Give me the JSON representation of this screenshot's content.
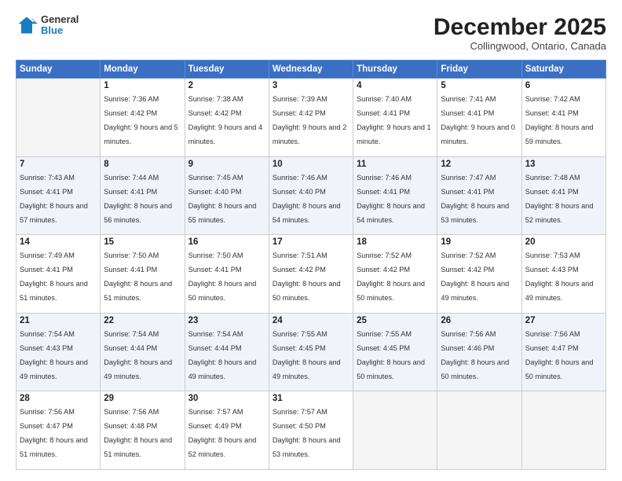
{
  "logo": {
    "general": "General",
    "blue": "Blue"
  },
  "header": {
    "month": "December 2025",
    "location": "Collingwood, Ontario, Canada"
  },
  "days_of_week": [
    "Sunday",
    "Monday",
    "Tuesday",
    "Wednesday",
    "Thursday",
    "Friday",
    "Saturday"
  ],
  "weeks": [
    [
      {
        "day": "",
        "empty": true
      },
      {
        "day": "1",
        "sunrise": "Sunrise: 7:36 AM",
        "sunset": "Sunset: 4:42 PM",
        "daylight": "Daylight: 9 hours and 5 minutes."
      },
      {
        "day": "2",
        "sunrise": "Sunrise: 7:38 AM",
        "sunset": "Sunset: 4:42 PM",
        "daylight": "Daylight: 9 hours and 4 minutes."
      },
      {
        "day": "3",
        "sunrise": "Sunrise: 7:39 AM",
        "sunset": "Sunset: 4:42 PM",
        "daylight": "Daylight: 9 hours and 2 minutes."
      },
      {
        "day": "4",
        "sunrise": "Sunrise: 7:40 AM",
        "sunset": "Sunset: 4:41 PM",
        "daylight": "Daylight: 9 hours and 1 minute."
      },
      {
        "day": "5",
        "sunrise": "Sunrise: 7:41 AM",
        "sunset": "Sunset: 4:41 PM",
        "daylight": "Daylight: 9 hours and 0 minutes."
      },
      {
        "day": "6",
        "sunrise": "Sunrise: 7:42 AM",
        "sunset": "Sunset: 4:41 PM",
        "daylight": "Daylight: 8 hours and 59 minutes."
      }
    ],
    [
      {
        "day": "7",
        "sunrise": "Sunrise: 7:43 AM",
        "sunset": "Sunset: 4:41 PM",
        "daylight": "Daylight: 8 hours and 57 minutes."
      },
      {
        "day": "8",
        "sunrise": "Sunrise: 7:44 AM",
        "sunset": "Sunset: 4:41 PM",
        "daylight": "Daylight: 8 hours and 56 minutes."
      },
      {
        "day": "9",
        "sunrise": "Sunrise: 7:45 AM",
        "sunset": "Sunset: 4:40 PM",
        "daylight": "Daylight: 8 hours and 55 minutes."
      },
      {
        "day": "10",
        "sunrise": "Sunrise: 7:46 AM",
        "sunset": "Sunset: 4:40 PM",
        "daylight": "Daylight: 8 hours and 54 minutes."
      },
      {
        "day": "11",
        "sunrise": "Sunrise: 7:46 AM",
        "sunset": "Sunset: 4:41 PM",
        "daylight": "Daylight: 8 hours and 54 minutes."
      },
      {
        "day": "12",
        "sunrise": "Sunrise: 7:47 AM",
        "sunset": "Sunset: 4:41 PM",
        "daylight": "Daylight: 8 hours and 53 minutes."
      },
      {
        "day": "13",
        "sunrise": "Sunrise: 7:48 AM",
        "sunset": "Sunset: 4:41 PM",
        "daylight": "Daylight: 8 hours and 52 minutes."
      }
    ],
    [
      {
        "day": "14",
        "sunrise": "Sunrise: 7:49 AM",
        "sunset": "Sunset: 4:41 PM",
        "daylight": "Daylight: 8 hours and 51 minutes."
      },
      {
        "day": "15",
        "sunrise": "Sunrise: 7:50 AM",
        "sunset": "Sunset: 4:41 PM",
        "daylight": "Daylight: 8 hours and 51 minutes."
      },
      {
        "day": "16",
        "sunrise": "Sunrise: 7:50 AM",
        "sunset": "Sunset: 4:41 PM",
        "daylight": "Daylight: 8 hours and 50 minutes."
      },
      {
        "day": "17",
        "sunrise": "Sunrise: 7:51 AM",
        "sunset": "Sunset: 4:42 PM",
        "daylight": "Daylight: 8 hours and 50 minutes."
      },
      {
        "day": "18",
        "sunrise": "Sunrise: 7:52 AM",
        "sunset": "Sunset: 4:42 PM",
        "daylight": "Daylight: 8 hours and 50 minutes."
      },
      {
        "day": "19",
        "sunrise": "Sunrise: 7:52 AM",
        "sunset": "Sunset: 4:42 PM",
        "daylight": "Daylight: 8 hours and 49 minutes."
      },
      {
        "day": "20",
        "sunrise": "Sunrise: 7:53 AM",
        "sunset": "Sunset: 4:43 PM",
        "daylight": "Daylight: 8 hours and 49 minutes."
      }
    ],
    [
      {
        "day": "21",
        "sunrise": "Sunrise: 7:54 AM",
        "sunset": "Sunset: 4:43 PM",
        "daylight": "Daylight: 8 hours and 49 minutes."
      },
      {
        "day": "22",
        "sunrise": "Sunrise: 7:54 AM",
        "sunset": "Sunset: 4:44 PM",
        "daylight": "Daylight: 8 hours and 49 minutes."
      },
      {
        "day": "23",
        "sunrise": "Sunrise: 7:54 AM",
        "sunset": "Sunset: 4:44 PM",
        "daylight": "Daylight: 8 hours and 49 minutes."
      },
      {
        "day": "24",
        "sunrise": "Sunrise: 7:55 AM",
        "sunset": "Sunset: 4:45 PM",
        "daylight": "Daylight: 8 hours and 49 minutes."
      },
      {
        "day": "25",
        "sunrise": "Sunrise: 7:55 AM",
        "sunset": "Sunset: 4:45 PM",
        "daylight": "Daylight: 8 hours and 50 minutes."
      },
      {
        "day": "26",
        "sunrise": "Sunrise: 7:56 AM",
        "sunset": "Sunset: 4:46 PM",
        "daylight": "Daylight: 8 hours and 50 minutes."
      },
      {
        "day": "27",
        "sunrise": "Sunrise: 7:56 AM",
        "sunset": "Sunset: 4:47 PM",
        "daylight": "Daylight: 8 hours and 50 minutes."
      }
    ],
    [
      {
        "day": "28",
        "sunrise": "Sunrise: 7:56 AM",
        "sunset": "Sunset: 4:47 PM",
        "daylight": "Daylight: 8 hours and 51 minutes."
      },
      {
        "day": "29",
        "sunrise": "Sunrise: 7:56 AM",
        "sunset": "Sunset: 4:48 PM",
        "daylight": "Daylight: 8 hours and 51 minutes."
      },
      {
        "day": "30",
        "sunrise": "Sunrise: 7:57 AM",
        "sunset": "Sunset: 4:49 PM",
        "daylight": "Daylight: 8 hours and 52 minutes."
      },
      {
        "day": "31",
        "sunrise": "Sunrise: 7:57 AM",
        "sunset": "Sunset: 4:50 PM",
        "daylight": "Daylight: 8 hours and 53 minutes."
      },
      {
        "day": "",
        "empty": true
      },
      {
        "day": "",
        "empty": true
      },
      {
        "day": "",
        "empty": true
      }
    ]
  ]
}
